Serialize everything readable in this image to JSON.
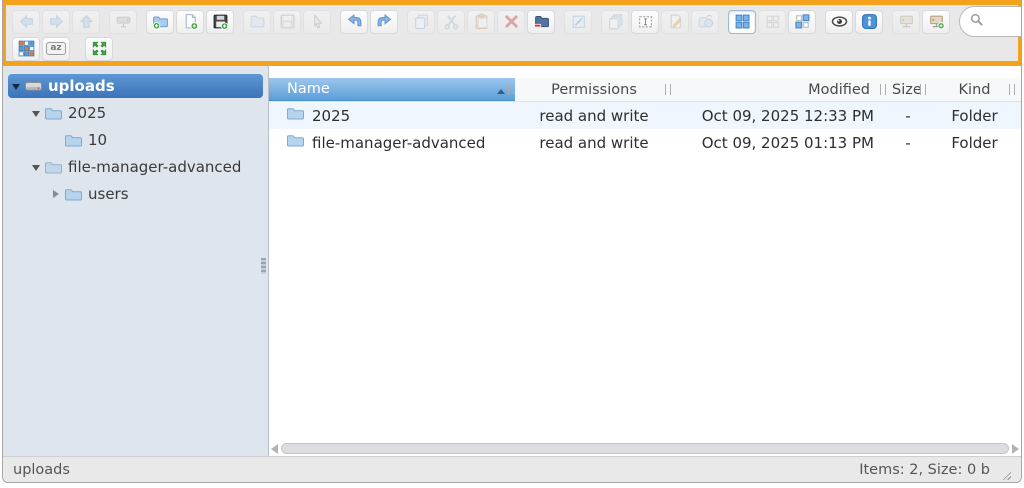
{
  "colors": {
    "highlight_orange": "#f4a11b",
    "selection_blue": "#3b74b8",
    "header_gradient_top": "#9cc6ec",
    "header_gradient_bottom": "#5a9fd9",
    "alt_row_blue": "#eff6fd",
    "toolbar_grey": "#e8e8e8",
    "sidebar_grey_blue": "#dfe5ec"
  },
  "toolbar": {
    "buttons_row1": [
      "back",
      "forward",
      "up",
      "network-drive",
      "new-folder",
      "new-text-file",
      "upload-files",
      "open",
      "download",
      "select-pointer",
      "undo",
      "redo",
      "copy",
      "cut",
      "paste",
      "delete",
      "empty-folder",
      "resize-image",
      "duplicate",
      "select-all",
      "edit-file",
      "archive",
      "view-icons",
      "view-compact",
      "view-sort",
      "preview",
      "info",
      "network-mount",
      "network-mount-add"
    ],
    "buttons_row2": [
      "view-mosaic",
      "sort-by-name",
      "fullscreen"
    ],
    "sort_badge": "az",
    "search": {
      "value": "",
      "placeholder": ""
    }
  },
  "tree": {
    "items": [
      {
        "label": "uploads",
        "level": 0,
        "type": "drive",
        "state": "expanded",
        "selected": true
      },
      {
        "label": "2025",
        "level": 1,
        "type": "folder",
        "state": "expanded",
        "selected": false
      },
      {
        "label": "10",
        "level": 2,
        "type": "folder",
        "state": "leaf",
        "selected": false
      },
      {
        "label": "file-manager-advanced",
        "level": 1,
        "type": "folder",
        "state": "expanded",
        "selected": false
      },
      {
        "label": "users",
        "level": 2,
        "type": "folder",
        "state": "collapsed",
        "selected": false
      }
    ]
  },
  "table": {
    "headers": {
      "name": "Name",
      "permissions": "Permissions",
      "modified": "Modified",
      "size": "Size",
      "kind": "Kind"
    },
    "sort": {
      "column": "Name",
      "direction": "asc"
    },
    "rows": [
      {
        "name": "2025",
        "permissions": "read and write",
        "modified": "Oct 09, 2025 12:33 PM",
        "size": "-",
        "kind": "Folder"
      },
      {
        "name": "file-manager-advanced",
        "permissions": "read and write",
        "modified": "Oct 09, 2025 01:13 PM",
        "size": "-",
        "kind": "Folder"
      }
    ]
  },
  "statusbar": {
    "path": "uploads",
    "summary": "Items: 2, Size: 0 b"
  }
}
